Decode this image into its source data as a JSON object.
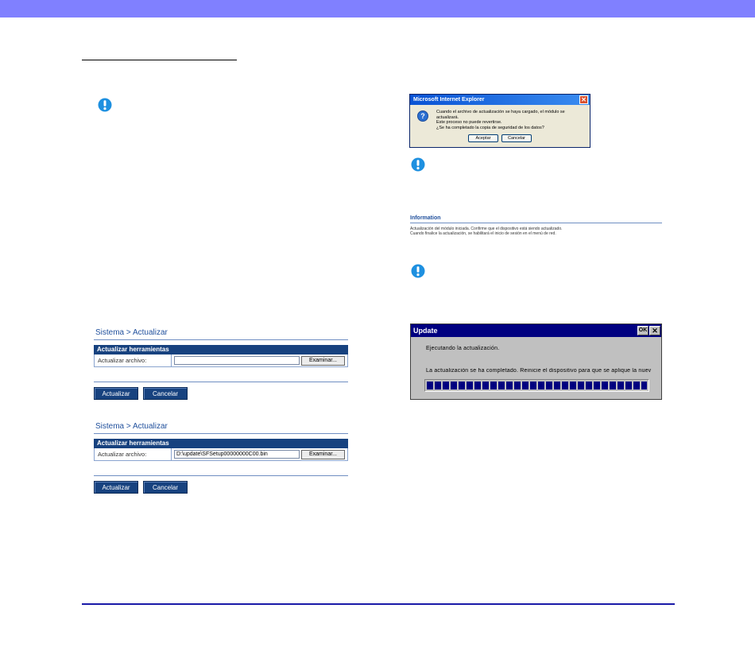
{
  "panels": [
    {
      "breadcrumb": "Sistema > Actualizar",
      "section_title": "Actualizar herramientas",
      "field_label": "Actualizar archivo:",
      "file_value": "",
      "browse_label": "Examinar...",
      "update_label": "Actualizar",
      "cancel_label": "Cancelar"
    },
    {
      "breadcrumb": "Sistema > Actualizar",
      "section_title": "Actualizar herramientas",
      "field_label": "Actualizar archivo:",
      "file_value": "D:\\update\\SFSetup00000000C00.bin",
      "browse_label": "Examinar...",
      "update_label": "Actualizar",
      "cancel_label": "Cancelar"
    }
  ],
  "ie_dialog": {
    "title": "Microsoft Internet Explorer",
    "close_glyph": "✕",
    "icon_glyph": "?",
    "message_lines": [
      "Cuando el archivo de actualización se haya cargado, el módulo se actualizará.",
      "Este proceso no puede revertirse.",
      "¿Se ha completado la copia de seguridad de los datos?"
    ],
    "accept_label": "Aceptar",
    "cancel_label": "Cancelar"
  },
  "information": {
    "title": "Information",
    "lines": [
      "Actualización del módulo iniciada. Confirme que el dispositivo está siendo actualizado.",
      "Cuando finalice la actualización, se habilitará el inicio de sesión en el menú de red."
    ]
  },
  "update_window": {
    "title": "Update",
    "ok_label": "OK",
    "close_glyph": "✕",
    "status_running": "Ejecutando la actualización.",
    "status_done": "La actualización se ha completado. Reinicie el dispositivo para que se aplique la nuev",
    "progress": 1.0
  },
  "icons": {
    "warning": "exclamation-circle-icon",
    "warning_color": "#1e90e0"
  },
  "colors": {
    "top_bar": "#8080ff",
    "footer_rule": "#1a1aa8",
    "panel_header": "#17427f",
    "breadcrumb_text": "#1f4f9c"
  }
}
